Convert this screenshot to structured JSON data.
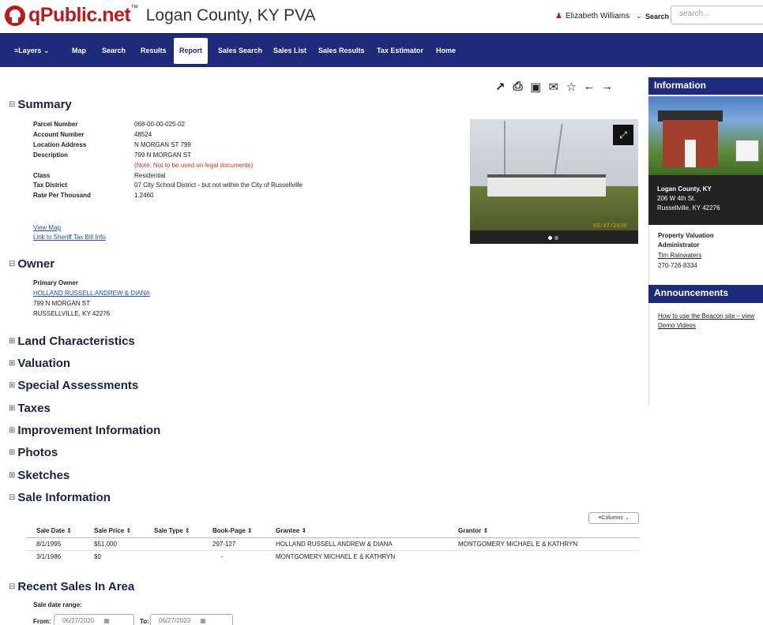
{
  "header": {
    "logo_text": "qPublic.net",
    "logo_tm": "™",
    "county_title": "Logan County, KY PVA",
    "user_name": "Elizabeth Williams",
    "search_label": "Search",
    "search_placeholder": "search..."
  },
  "nav": {
    "items": [
      "Layers",
      "Map",
      "Search",
      "Results",
      "Report",
      "Sales Search",
      "Sales List",
      "Sales Results",
      "Tax Estimator",
      "Home"
    ],
    "active": "Report"
  },
  "toolbar": {
    "icons": [
      "share-icon",
      "print-icon",
      "image-icon",
      "email-icon",
      "star-icon",
      "arrow-left-icon",
      "arrow-right-icon"
    ]
  },
  "summary": {
    "title": "Summary",
    "fields": [
      {
        "label": "Parcel Number",
        "value": "068-00-00-025-02"
      },
      {
        "label": "Account Number",
        "value": "48524"
      },
      {
        "label": "Location Address",
        "value": "N MORGAN ST 799"
      },
      {
        "label": "Description",
        "value": "799 N MORGAN ST"
      },
      {
        "label": "",
        "value": "(Note: Not to be used on legal documents)"
      },
      {
        "label": "Class",
        "value": "Residential"
      },
      {
        "label": "Tax District",
        "value": "07 City School District - but not within the City of Russellville"
      },
      {
        "label": "Rate Per Thousand",
        "value": "1.2460"
      }
    ],
    "links": [
      "View Map",
      "Link to Sheriff Tax Bill Info"
    ]
  },
  "photo": {
    "date_stamp": "03/07/2019"
  },
  "owner": {
    "title": "Owner",
    "label": "Primary Owner",
    "name": "HOLLAND RUSSELL ANDREW & DIANA",
    "address1": "799 N MORGAN ST",
    "address2": "RUSSELLVILLE, KY 42276"
  },
  "collapsed_sections": [
    "Land Characteristics",
    "Valuation",
    "Special Assessments",
    "Taxes",
    "Improvement Information",
    "Photos",
    "Sketches"
  ],
  "sales": {
    "title": "Sale Information",
    "columns_button": "Columns",
    "headers": [
      "Sale Date",
      "Sale Price",
      "Sale Type",
      "Book-Page",
      "Grantee",
      "Grantor"
    ],
    "rows": [
      [
        "8/1/1995",
        "$51,000",
        "",
        "297-127",
        "HOLLAND RUSSELL ANDREW & DIANA",
        "MONTGOMERY MICHAEL E & KATHRYN"
      ],
      [
        "3/1/1986",
        "$0",
        "",
        "-",
        "MONTGOMERY MICHAEL E & KATHRYN",
        ""
      ]
    ]
  },
  "recent_sales": {
    "title": "Recent Sales In Area",
    "range_label": "Sale date range:",
    "from_label": "From:",
    "from_value": "06/27/2020",
    "to_label": "To:",
    "to_value": "06/27/2023"
  },
  "sidebar": {
    "info_title": "Information",
    "office_name": "Logan County, KY",
    "office_street": "206 W 4th St.",
    "office_city": "Russellville, KY 42276",
    "role_line1": "Property Valuation",
    "role_line2": "Administrator",
    "admin_name": "Tim Rainwaters",
    "phone": "270-726-8334",
    "announcements_title": "Announcements",
    "announce_link1": "How to use the Beacon site – view",
    "announce_link2": "Demo Videos"
  },
  "colors": {
    "brand_red": "#b91c1c",
    "nav_blue": "#1f2a7a"
  }
}
